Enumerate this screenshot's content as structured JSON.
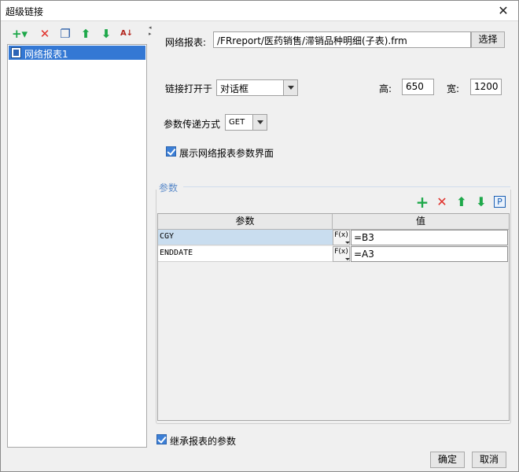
{
  "window": {
    "title": "超级链接",
    "close_glyph": "✕"
  },
  "left_toolbar": {
    "icons": [
      "add-icon",
      "delete-icon",
      "copy-icon",
      "move-up-icon",
      "move-down-icon",
      "sort-az-icon"
    ],
    "add_glyph": "+▾",
    "delete_glyph": "✕",
    "copy_glyph": "❐",
    "up_glyph": "⬆",
    "down_glyph": "⬇",
    "sort_glyph": "A↓"
  },
  "tree": {
    "items": [
      {
        "label": "网络报表1",
        "selected": true
      }
    ]
  },
  "form": {
    "report_label": "网络报表:",
    "report_path": "/FRreport/医药销售/滞销品种明细(子表).frm",
    "select_button": "选择",
    "open_in_label": "链接打开于",
    "open_in_value": "对话框",
    "height_label": "高:",
    "height_value": "650",
    "width_label": "宽:",
    "width_value": "1200",
    "param_method_label": "参数传递方式",
    "param_method_value": "GET",
    "show_params_label": "展示网络报表参数界面",
    "show_params_checked": true
  },
  "params": {
    "group_title": "参数",
    "toolbar_glyphs": {
      "add": "+",
      "delete": "✕",
      "up": "⬆",
      "down": "⬇",
      "param": "P"
    },
    "columns": [
      "参数",
      "值"
    ],
    "fx_label": "F(x)",
    "rows": [
      {
        "name": "CGY",
        "value": "=B3"
      },
      {
        "name": "ENDDATE",
        "value": "=A3"
      }
    ]
  },
  "inherit_params_label": "继承报表的参数",
  "inherit_params_checked": true,
  "buttons": {
    "ok": "确定",
    "cancel": "取消"
  },
  "colors": {
    "selection": "#3478d4",
    "add_green": "#1ea84a",
    "delete_red": "#e0302a",
    "arrow_green": "#1ea84a"
  }
}
